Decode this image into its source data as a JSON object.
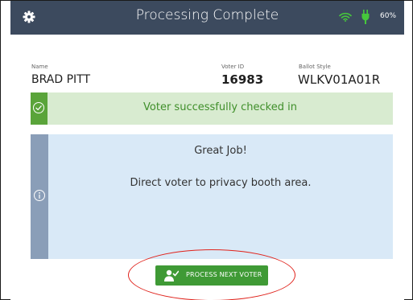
{
  "header": {
    "title": "Processing Complete",
    "battery_text": "60%",
    "background": "#3c4a5e",
    "status_icon_color": "#46c83c",
    "icons": [
      "gear-icon",
      "wifi-icon",
      "plug-icon"
    ]
  },
  "voter": {
    "name_label": "Name",
    "name": "BRAD PITT",
    "voter_id_label": "Voter ID",
    "voter_id": "16983",
    "ballot_style_label": "Ballot Style",
    "ballot_style": "WLKV01A01R"
  },
  "success_banner": {
    "message": "Voter successfully checked in",
    "icon": "check-circle-icon",
    "accent": "#5aa43a"
  },
  "info_panel": {
    "title": "Great Job!",
    "message": "Direct voter to privacy booth area.",
    "icon": "info-icon",
    "accent": "#8a9eb8"
  },
  "actions": {
    "next_voter_label": "PROCESS NEXT VOTER",
    "icon": "person-check-icon",
    "button_color": "#3f9a35",
    "highlight_color": "#e0241d"
  }
}
